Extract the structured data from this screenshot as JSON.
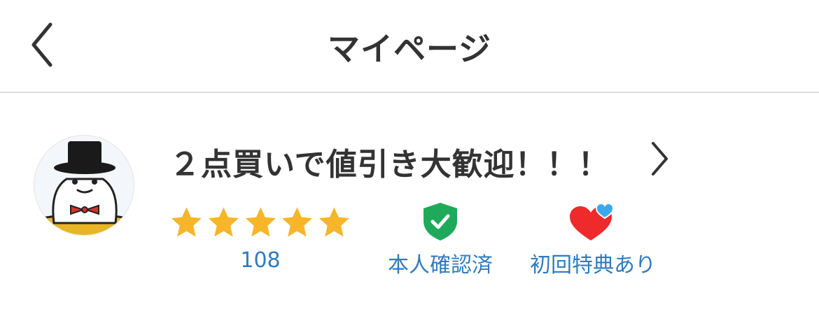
{
  "header": {
    "title": "マイページ",
    "back_icon": "chevron-left-icon"
  },
  "profile": {
    "shop_name": "２点買いで値引き大歓迎！！！",
    "avatar_icon": "mascot-avatar",
    "rating": {
      "stars": 5,
      "max_stars": 5,
      "count": "108"
    },
    "badges": [
      {
        "label": "本人確認済",
        "icon": "verified-shield-icon"
      },
      {
        "label": "初回特典あり",
        "icon": "hearts-icon"
      }
    ]
  },
  "colors": {
    "title_text": "#333333",
    "link_blue": "#2f7bbf",
    "star": "#f7b52a",
    "verified_green": "#1eaa5a",
    "heart_red": "#ee2a2a",
    "heart_blue": "#3aa8ee"
  }
}
